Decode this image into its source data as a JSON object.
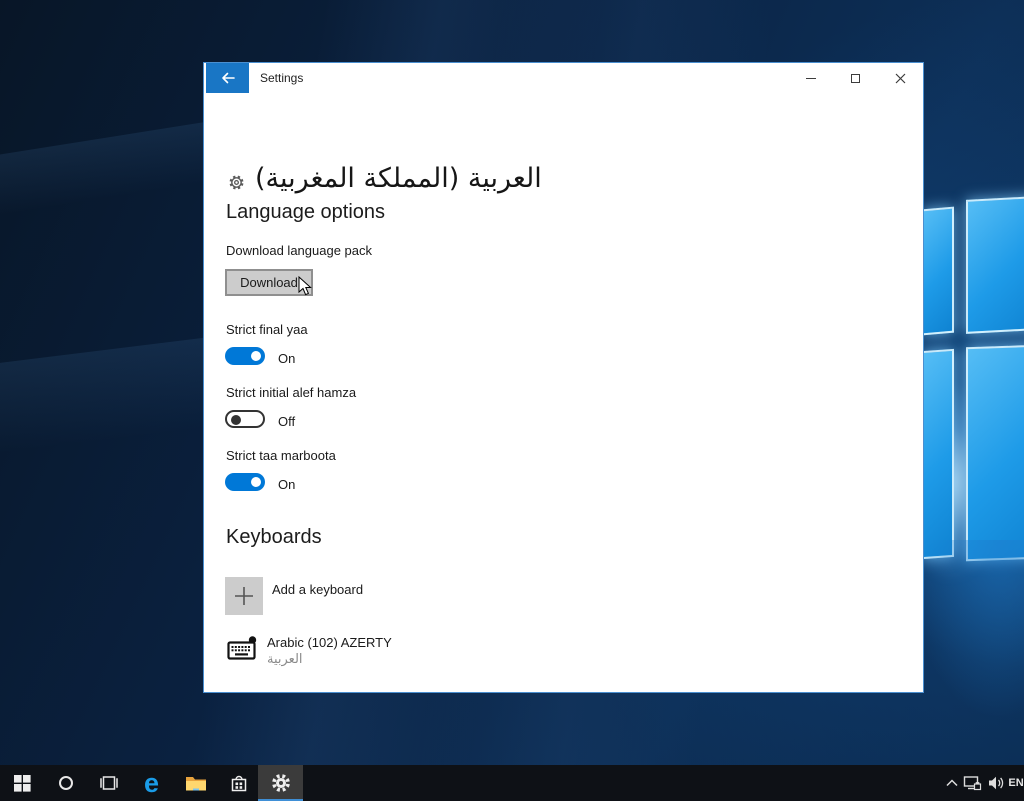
{
  "colors": {
    "accent_blue": "#0078d7",
    "titlebar_back_bg": "#1976c5",
    "window_border": "#4a8fd0",
    "button_bg": "#cccccc",
    "button_border": "#8f8f8f",
    "taskbar_bg": "#0e1116",
    "taskbar_active_bg": "#3b3b3b",
    "taskbar_underline": "#3f8fd6",
    "wallpaper_logo_blue": "#1e9be8"
  },
  "window": {
    "titlebar": {
      "title": "Settings",
      "back_icon": "left-arrow-icon",
      "minimize_icon": "minimize-icon",
      "maximize_icon": "maximize-icon",
      "close_icon": "close-icon"
    },
    "page": {
      "gear_icon": "gear-icon",
      "title": "العربية (المملكة المغربية)",
      "language_options": {
        "heading": "Language options",
        "download_label": "Download language pack",
        "download_button": "Download"
      },
      "toggles": [
        {
          "label": "Strict final yaa",
          "state": "on",
          "state_label": "On"
        },
        {
          "label": "Strict initial alef hamza",
          "state": "off",
          "state_label": "Off"
        },
        {
          "label": "Strict taa marboota",
          "state": "on",
          "state_label": "On"
        }
      ],
      "keyboards": {
        "heading": "Keyboards",
        "add_button_label": "Add a keyboard",
        "items": [
          {
            "title": "Arabic (102) AZERTY",
            "subtitle": "العربية"
          }
        ]
      }
    }
  },
  "taskbar": {
    "items": [
      "start",
      "search",
      "task-view",
      "edge",
      "file-explorer",
      "store",
      "settings"
    ],
    "active_item": "settings",
    "tray": {
      "chevron_icon": "chevron-up-icon",
      "network_icon": "network-icon",
      "volume_icon": "volume-icon",
      "language_label": "EN"
    }
  }
}
